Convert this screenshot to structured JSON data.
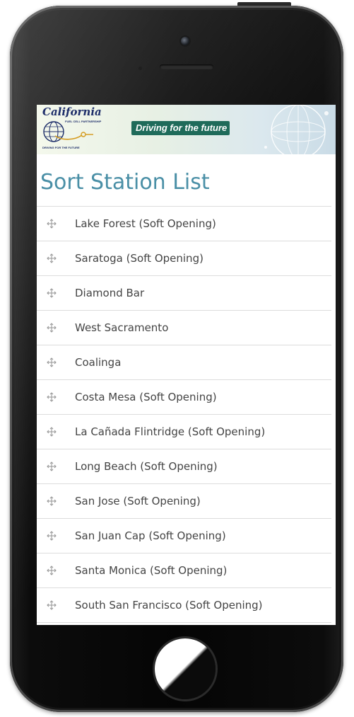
{
  "banner": {
    "logo_title": "California",
    "logo_subtitle": "FUEL CELL PARTNERSHIP",
    "logo_tagline": "DRIVING FOR THE FUTURE",
    "slogan": "Driving for the future"
  },
  "page": {
    "title": "Sort Station List"
  },
  "stations": [
    {
      "label": "Lake Forest (Soft Opening)",
      "icon": "drag-move-icon"
    },
    {
      "label": "Saratoga (Soft Opening)",
      "icon": "drag-move-icon"
    },
    {
      "label": "Diamond Bar",
      "icon": "drag-move-icon"
    },
    {
      "label": "West Sacramento",
      "icon": "drag-move-icon"
    },
    {
      "label": "Coalinga",
      "icon": "drag-move-icon"
    },
    {
      "label": "Costa Mesa (Soft Opening)",
      "icon": "drag-move-icon"
    },
    {
      "label": "La Cañada Flintridge (Soft Opening)",
      "icon": "drag-move-icon"
    },
    {
      "label": "Long Beach (Soft Opening)",
      "icon": "drag-move-icon"
    },
    {
      "label": "San Jose (Soft Opening)",
      "icon": "drag-move-icon"
    },
    {
      "label": "San Juan Cap (Soft Opening)",
      "icon": "drag-move-icon"
    },
    {
      "label": "Santa Monica (Soft Opening)",
      "icon": "drag-move-icon"
    },
    {
      "label": "South San Francisco (Soft Opening)",
      "icon": "drag-move-icon"
    }
  ],
  "colors": {
    "title": "#4a8fa6",
    "slogan_bg": "#1f6b5a",
    "logo": "#1e2e6a",
    "divider": "#dcdcdc"
  }
}
